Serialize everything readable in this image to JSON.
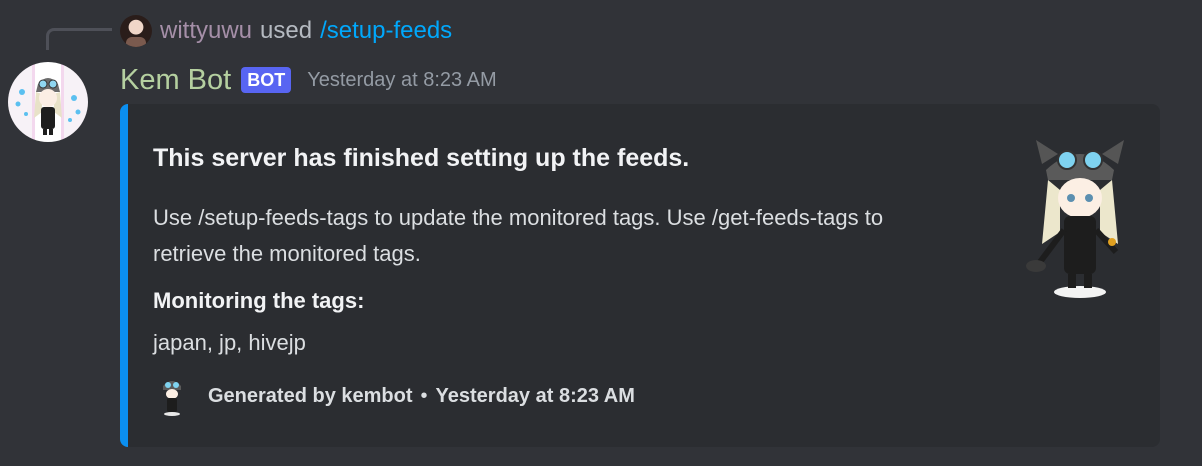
{
  "interaction": {
    "user": "wittyuwu",
    "used_text": "used",
    "command": "/setup-feeds"
  },
  "message": {
    "author": "Kem Bot",
    "bot_tag": "BOT",
    "timestamp": "Yesterday at 8:23 AM"
  },
  "embed": {
    "accent_color": "#0b8ff0",
    "title": "This server has finished setting up the feeds.",
    "description": "Use /setup-feeds-tags to update the monitored tags. Use /get-feeds-tags to retrieve the monitored tags.",
    "field": {
      "name": "Monitoring the tags:",
      "value": "japan, jp, hivejp"
    },
    "footer": {
      "text": "Generated by kembot",
      "separator": "•",
      "timestamp": "Yesterday at 8:23 AM"
    }
  },
  "icons": {
    "reply_avatar": "user-avatar",
    "bot_avatar": "anime-girl-avatar",
    "thumbnail": "anime-girl-thumbnail",
    "footer_icon": "anime-girl-footer-icon"
  }
}
